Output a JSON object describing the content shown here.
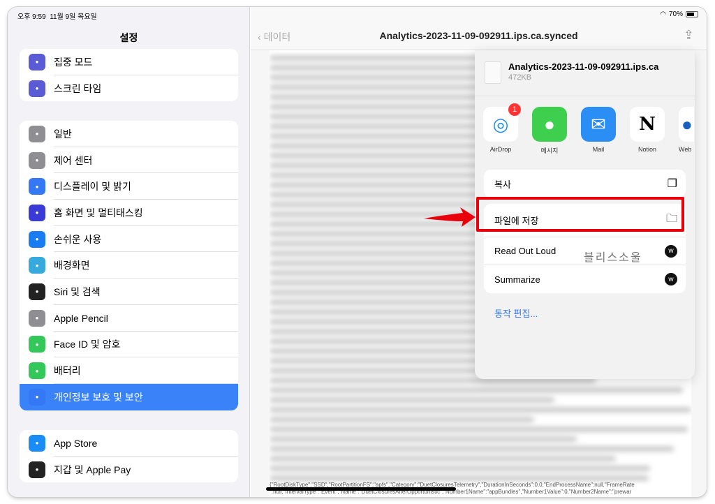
{
  "status": {
    "time": "오후 9:59",
    "date": "11월 9일 목요일",
    "battery": "70%",
    "battery_level": 0.7
  },
  "sidebar": {
    "title": "설정",
    "groups": [
      [
        {
          "label": "집중 모드",
          "icon": "moon-icon",
          "color": "#5b5bd6"
        },
        {
          "label": "스크린 타임",
          "icon": "hourglass-icon",
          "color": "#5b5bd6"
        }
      ],
      [
        {
          "label": "일반",
          "icon": "gear-icon",
          "color": "#8e8e93"
        },
        {
          "label": "제어 센터",
          "icon": "toggles-icon",
          "color": "#8e8e93"
        },
        {
          "label": "디스플레이 및 밝기",
          "icon": "text-size-icon",
          "color": "#3478f6"
        },
        {
          "label": "홈 화면 및 멀티태스킹",
          "icon": "grid-icon",
          "color": "#3a3ad6"
        },
        {
          "label": "손쉬운 사용",
          "icon": "accessibility-icon",
          "color": "#1a7cf2"
        },
        {
          "label": "배경화면",
          "icon": "flower-icon",
          "color": "#36aadc"
        },
        {
          "label": "Siri 및 검색",
          "icon": "siri-icon",
          "color": "#222"
        },
        {
          "label": "Apple Pencil",
          "icon": "pencil-icon",
          "color": "#8e8e93"
        },
        {
          "label": "Face ID 및 암호",
          "icon": "faceid-icon",
          "color": "#34c759"
        },
        {
          "label": "배터리",
          "icon": "battery-icon",
          "color": "#34c759"
        },
        {
          "label": "개인정보 보호 및 보안",
          "icon": "hand-icon",
          "color": "#3478f6",
          "selected": true
        }
      ],
      [
        {
          "label": "App Store",
          "icon": "appstore-icon",
          "color": "#1a8cf5"
        },
        {
          "label": "지갑 및 Apple Pay",
          "icon": "wallet-icon",
          "color": "#222"
        }
      ]
    ]
  },
  "nav": {
    "back": "데이터",
    "title": "Analytics-2023-11-09-092911.ips.ca.synced"
  },
  "content": {
    "line1": "{\"RootDiskType\":\"SSD\",\"RootPartitionFS\":\"apfs\",\"Category\":\"DuetClosuresTelemetry\",\"DurationInSeconds\":0.0,\"EndProcessName\":null,\"FrameRate",
    "line2": "\":null,\"IntervalType\":\"Event\",\"Name\":\"DuetClosuresAfterOpportunistic\",\"Number1Name\":\"appBundles\",\"Number1Value\":0,\"Number2Name\":\"prewar"
  },
  "share": {
    "file_name": "Analytics-2023-11-09-092911.ips.ca",
    "file_size": "472KB",
    "apps": [
      {
        "label": "AirDrop",
        "badge": "1"
      },
      {
        "label": "메시지"
      },
      {
        "label": "Mail"
      },
      {
        "label": "Notion"
      },
      {
        "label": "Web"
      }
    ],
    "actions": [
      {
        "label": "복사",
        "icon": "copy-icon"
      },
      {
        "label": "파일에 저장",
        "icon": "folder-icon"
      },
      {
        "label": "Read Out Loud",
        "icon": "app-icon"
      },
      {
        "label": "Summarize",
        "icon": "app-icon"
      }
    ],
    "edit": "동작 편집..."
  },
  "highlight_color": "#e8000b",
  "watermark": "블리스소울"
}
